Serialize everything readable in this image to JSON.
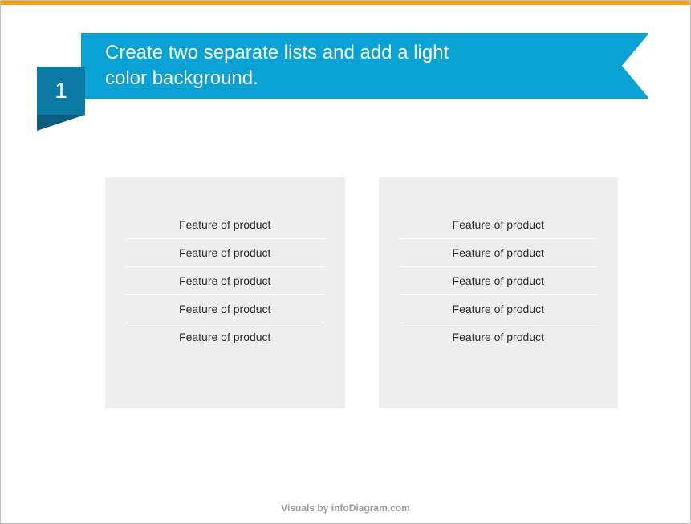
{
  "step_number": "1",
  "title": "Create two separate lists and add a light color background.",
  "lists": {
    "left": [
      "Feature of product",
      "Feature of product",
      "Feature of product",
      "Feature of product",
      "Feature of product"
    ],
    "right": [
      "Feature of product",
      "Feature of product",
      "Feature of product",
      "Feature of product",
      "Feature of product"
    ]
  },
  "footer": "Visuals by infoDiagram.com"
}
